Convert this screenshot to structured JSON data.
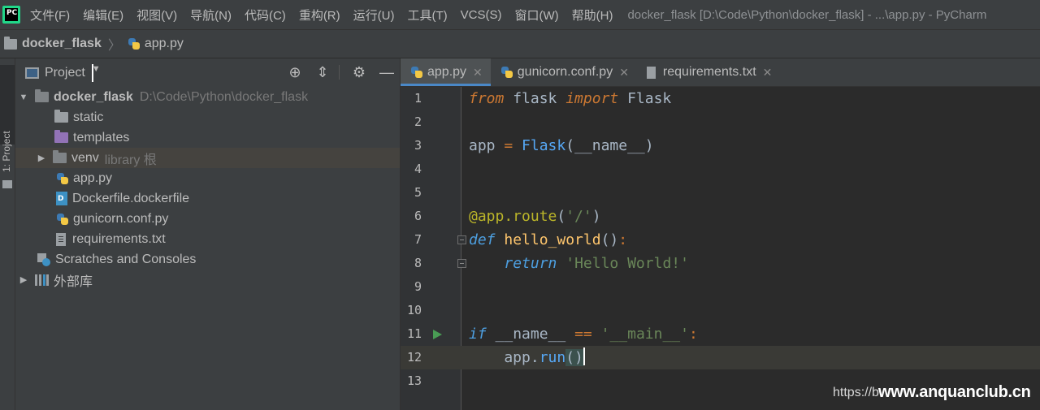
{
  "menubar": {
    "app_icon_label": "PC",
    "items": [
      "文件(F)",
      "编辑(E)",
      "视图(V)",
      "导航(N)",
      "代码(C)",
      "重构(R)",
      "运行(U)",
      "工具(T)",
      "VCS(S)",
      "窗口(W)",
      "帮助(H)"
    ],
    "window_title": "docker_flask [D:\\Code\\Python\\docker_flask] - ...\\app.py - PyCharm"
  },
  "navbar": {
    "project": "docker_flask",
    "file": "app.py"
  },
  "tool_strip": {
    "label": "1: Project"
  },
  "project_panel": {
    "title": "Project",
    "tools": [
      "target-icon",
      "collapse-icon",
      "gear-icon",
      "minimize-icon"
    ],
    "tree": {
      "root": {
        "label": "docker_flask",
        "path": "D:\\Code\\Python\\docker_flask"
      },
      "static": "static",
      "templates": "templates",
      "venv": {
        "label": "venv",
        "hint": "library 根"
      },
      "files": [
        "app.py",
        "Dockerfile.dockerfile",
        "gunicorn.conf.py",
        "requirements.txt"
      ],
      "scratches": "Scratches and Consoles",
      "external": "外部库"
    }
  },
  "editor": {
    "tabs": [
      {
        "label": "app.py",
        "active": true
      },
      {
        "label": "gunicorn.conf.py",
        "active": false
      },
      {
        "label": "requirements.txt",
        "active": false
      }
    ],
    "line_numbers": [
      "1",
      "2",
      "3",
      "4",
      "5",
      "6",
      "7",
      "8",
      "9",
      "10",
      "11",
      "12",
      "13"
    ],
    "current_line": "12"
  },
  "colors": {
    "keyword": "#cc7832",
    "string": "#6a8759",
    "function": "#ffc66d",
    "decorator": "#bbb529",
    "accent": "#4a88c7"
  },
  "watermark": {
    "url": "https://b",
    "site": "www.anquanclub.cn"
  }
}
